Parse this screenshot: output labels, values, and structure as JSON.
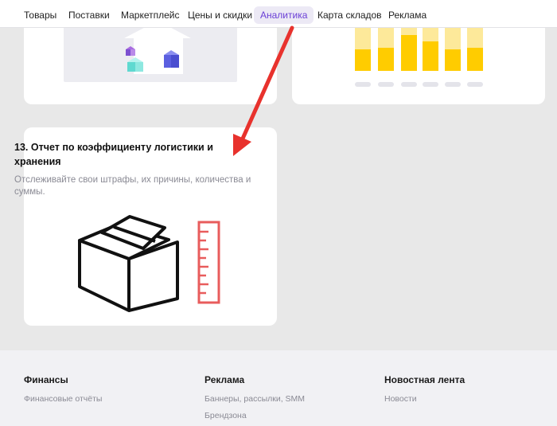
{
  "nav": {
    "tabs": [
      {
        "label": "Товары"
      },
      {
        "label": "Поставки"
      },
      {
        "label": "Маркетплейс"
      },
      {
        "label": "Цены и скидки"
      },
      {
        "label": "Аналитика",
        "active": true
      },
      {
        "label": "Карта складов"
      },
      {
        "label": "Реклама"
      }
    ]
  },
  "report_card": {
    "title": "13. Отчет по коэффициенту логистики и хранения",
    "description": "Отслеживайте свои штрафы, их причины, количества и суммы."
  },
  "footer": {
    "columns": [
      {
        "title": "Финансы",
        "links": [
          "Финансовые отчёты"
        ]
      },
      {
        "title": "Реклама",
        "links": [
          "Баннеры, рассылки, SMM",
          "Брендзона"
        ]
      },
      {
        "title": "Новостная лента",
        "links": [
          "Новости"
        ]
      }
    ]
  },
  "colors": {
    "accent": "#6a3fd6",
    "arrow": "#e8322d",
    "ruler": "#e85c5c",
    "bar_yellow": "#ffcc00",
    "bar_light": "#fde99a"
  }
}
